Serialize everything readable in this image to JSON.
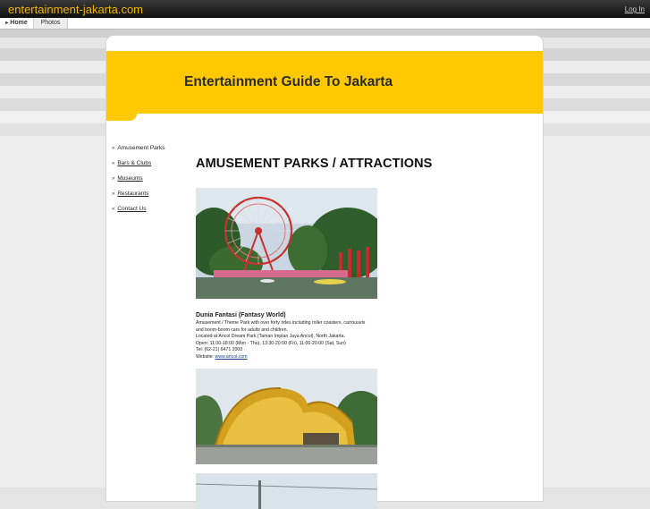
{
  "header": {
    "site_title": "entertainment-jakarta.com",
    "login_label": "Log In"
  },
  "tabs": [
    {
      "label": "Home",
      "active": true
    },
    {
      "label": "Photos",
      "active": false
    }
  ],
  "banner": {
    "title": "Entertainment Guide To Jakarta"
  },
  "sidebar": {
    "items": [
      {
        "label": "Amusement Parks",
        "current": true
      },
      {
        "label": "Bars & Clubs",
        "current": false
      },
      {
        "label": "Museums",
        "current": false
      },
      {
        "label": "Restaurants",
        "current": false
      },
      {
        "label": "Contact Us",
        "current": false
      }
    ]
  },
  "main": {
    "heading": "AMUSEMENT PARKS / ATTRACTIONS",
    "entry": {
      "name": "Dunia Fantasi (Fantasy World)",
      "desc1": "Amusement / Theme Park with over forty rides including roller coasters, carrousels",
      "desc2": "and boom-boom cars for adults and children.",
      "location": "Located at Ancol Dream Park (Taman Impian Jaya Ancol), North Jakarta.",
      "hours": "Open: 11:00-18:00 (Mon - Thu), 13:30-20:00 (Fri), 11:00-20:00 (Sat, Sun)",
      "tel": "Tel: (62-21) 6471 2000",
      "website_label": "Website: ",
      "website_link": "www.ancol.com"
    }
  },
  "colors": {
    "accent_yellow": "#ffc800",
    "site_title_orange": "#f2b400"
  }
}
